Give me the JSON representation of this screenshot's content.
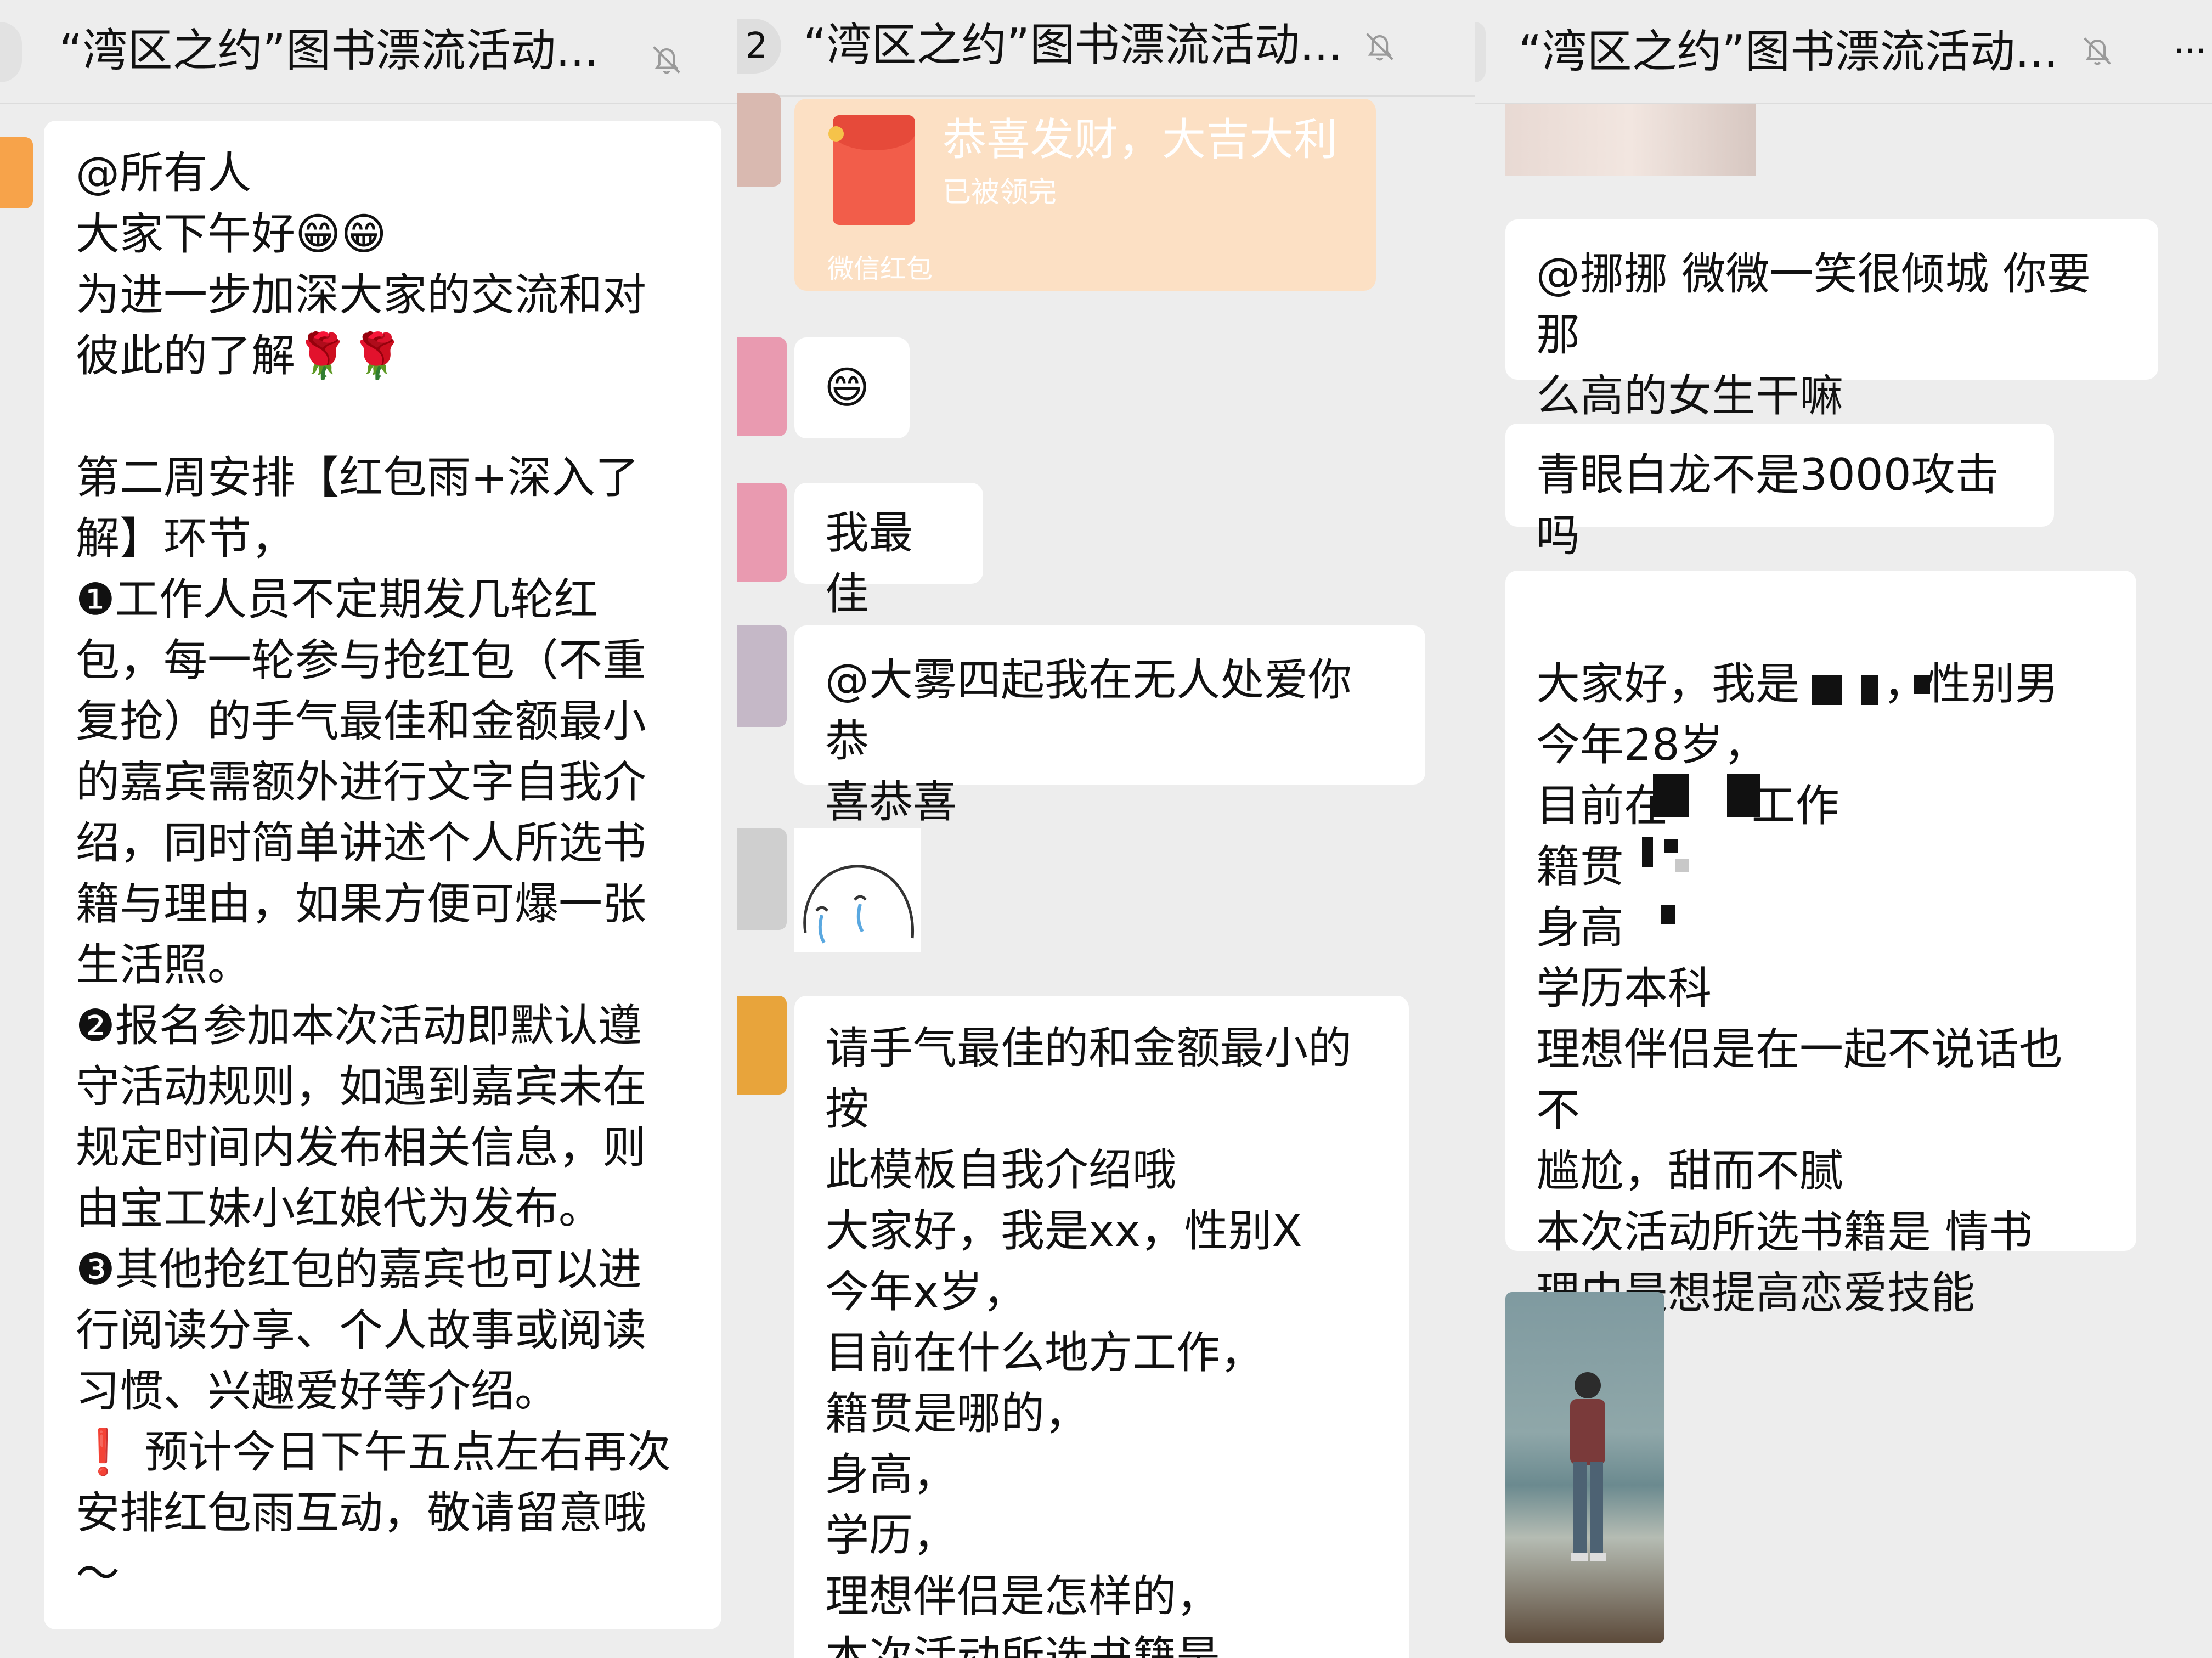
{
  "chat_title": "“湾区之约”图书漂流活动...",
  "panel2_badge": "2",
  "panel1": {
    "announcement": "@所有人\n大家下午好😁😁\n为进一步加深大家的交流和对\n彼此的了解🌹🌹\n\n第二周安排【红包雨+深入了\n解】环节，\n❶工作人员不定期发几轮红\n包，每一轮参与抢红包（不重\n复抢）的手气最佳和金额最小\n的嘉宾需额外进行文字自我介\n绍，同时简单讲述个人所选书\n籍与理由，如果方便可爆一张\n生活照。\n❷报名参加本次活动即默认遵\n守活动规则，如遇到嘉宾未在\n规定时间内发布相关信息，则\n由宝工妹小红娘代为发布。\n❸其他抢红包的嘉宾也可以进\n行阅读分享、个人故事或阅读\n习惯、兴趣爱好等介绍。\n❗ 预计今日下午五点左右再次\n安排红包雨互动，敬请留意哦\n～"
  },
  "panel2": {
    "red_packet": {
      "title": "恭喜发财，大吉大利",
      "status": "已被领完",
      "footer": "微信红包"
    },
    "msg_emoji": "😄",
    "msg_best": "我最佳",
    "msg_mention": "@大雾四起我在无人处爱你 恭\n喜恭喜",
    "msg_template": "请手气最佳的和金额最小的按\n此模板自我介绍哦\n大家好，我是xx，性别X\n今年x岁，\n目前在什么地方工作，\n籍贯是哪的，\n身高，\n学历，\n理想伴侣是怎样的，\n本次活动所选书籍是\n理由是"
  },
  "panel3": {
    "msg_mention": "@挪挪 微微一笑很倾城 你要那\n么高的女生干嘛",
    "msg_dragon": "青眼白龙不是3000攻击吗",
    "msg_intro": "\n大家好，我是      ，性别男\n今年28岁，\n目前在      工作\n籍贯\n身高\n学历本科\n理想伴侣是在一起不说话也不\n尴尬，甜而不腻\n本次活动所选书籍是 情书\n理由是想提高恋爱技能"
  },
  "colors": {
    "background": "#ededed",
    "bubble": "#ffffff",
    "red_packet": "#fce0c4"
  },
  "icons": [
    "mute-bell-icon",
    "more-icon",
    "red-envelope-icon"
  ]
}
